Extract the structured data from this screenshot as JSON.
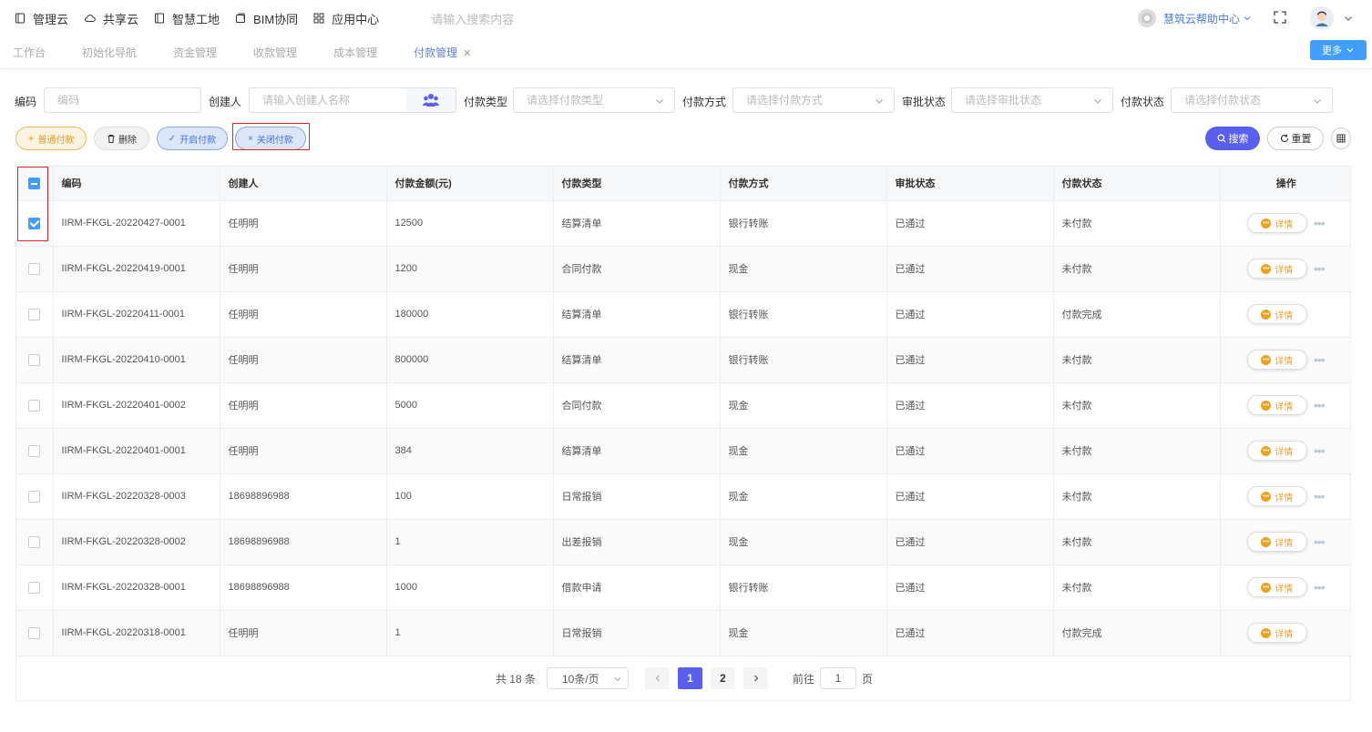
{
  "topnav": [
    {
      "label": "管理云",
      "icon": "book-icon"
    },
    {
      "label": "共享云",
      "icon": "cloud-icon"
    },
    {
      "label": "智慧工地",
      "icon": "book-icon"
    },
    {
      "label": "BIM协同",
      "icon": "cube-icon"
    },
    {
      "label": "应用中心",
      "icon": "grid-icon"
    }
  ],
  "top_search_placeholder": "请输入搜索内容",
  "help_center": "慧筑云帮助中心",
  "tabs": [
    {
      "label": "工作台",
      "active": false
    },
    {
      "label": "初始化导航",
      "active": false
    },
    {
      "label": "资金管理",
      "active": false
    },
    {
      "label": "收款管理",
      "active": false
    },
    {
      "label": "成本管理",
      "active": false
    },
    {
      "label": "付款管理",
      "active": true,
      "closable": true
    }
  ],
  "more_label": "更多",
  "filters": {
    "code_label": "编码",
    "code_placeholder": "编码",
    "creator_label": "创建人",
    "creator_placeholder": "请输入创建人名称",
    "type_label": "付款类型",
    "type_placeholder": "请选择付款类型",
    "method_label": "付款方式",
    "method_placeholder": "请选择付款方式",
    "approval_label": "审批状态",
    "approval_placeholder": "请选择审批状态",
    "paystatus_label": "付款状态",
    "paystatus_placeholder": "请选择付款状态"
  },
  "actions": {
    "normal_pay": "普通付款",
    "delete": "删除",
    "open_pay": "开启付款",
    "close_pay": "关闭付款",
    "search": "搜索",
    "reset": "重置"
  },
  "table": {
    "headers": [
      "编码",
      "创建人",
      "付款金额(元)",
      "付款类型",
      "付款方式",
      "审批状态",
      "付款状态",
      "操作"
    ],
    "detail_label": "详情",
    "rows": [
      {
        "checked": true,
        "code": "IIRM-FKGL-20220427-0001",
        "creator": "任明明",
        "amount": "12500",
        "type": "结算清单",
        "method": "银行转账",
        "approval": "已通过",
        "status": "未付款",
        "more": true
      },
      {
        "checked": false,
        "code": "IIRM-FKGL-20220419-0001",
        "creator": "任明明",
        "amount": "1200",
        "type": "合同付款",
        "method": "现金",
        "approval": "已通过",
        "status": "未付款",
        "more": true
      },
      {
        "checked": false,
        "code": "IIRM-FKGL-20220411-0001",
        "creator": "任明明",
        "amount": "180000",
        "type": "结算清单",
        "method": "银行转账",
        "approval": "已通过",
        "status": "付款完成",
        "more": false
      },
      {
        "checked": false,
        "code": "IIRM-FKGL-20220410-0001",
        "creator": "任明明",
        "amount": "800000",
        "type": "结算清单",
        "method": "银行转账",
        "approval": "已通过",
        "status": "未付款",
        "more": true
      },
      {
        "checked": false,
        "code": "IIRM-FKGL-20220401-0002",
        "creator": "任明明",
        "amount": "5000",
        "type": "合同付款",
        "method": "现金",
        "approval": "已通过",
        "status": "未付款",
        "more": true
      },
      {
        "checked": false,
        "code": "IIRM-FKGL-20220401-0001",
        "creator": "任明明",
        "amount": "384",
        "type": "结算清单",
        "method": "现金",
        "approval": "已通过",
        "status": "未付款",
        "more": true
      },
      {
        "checked": false,
        "code": "IIRM-FKGL-20220328-0003",
        "creator": "18698896988",
        "amount": "100",
        "type": "日常报销",
        "method": "现金",
        "approval": "已通过",
        "status": "未付款",
        "more": true
      },
      {
        "checked": false,
        "code": "IIRM-FKGL-20220328-0002",
        "creator": "18698896988",
        "amount": "1",
        "type": "出差报销",
        "method": "现金",
        "approval": "已通过",
        "status": "未付款",
        "more": true
      },
      {
        "checked": false,
        "code": "IIRM-FKGL-20220328-0001",
        "creator": "18698896988",
        "amount": "1000",
        "type": "借款申请",
        "method": "银行转账",
        "approval": "已通过",
        "status": "未付款",
        "more": true
      },
      {
        "checked": false,
        "code": "IIRM-FKGL-20220318-0001",
        "creator": "任明明",
        "amount": "1",
        "type": "日常报销",
        "method": "现金",
        "approval": "已通过",
        "status": "付款完成",
        "more": false
      }
    ]
  },
  "pagination": {
    "total": "共 18 条",
    "page_size": "10条/页",
    "pages": [
      "1",
      "2"
    ],
    "current": "1",
    "goto_label": "前往",
    "goto_value": "1",
    "page_suffix": "页"
  },
  "colors": {
    "accent": "#5b5ff0",
    "primary": "#409eff",
    "warning": "#f0a020",
    "highlight": "#e0242b"
  }
}
